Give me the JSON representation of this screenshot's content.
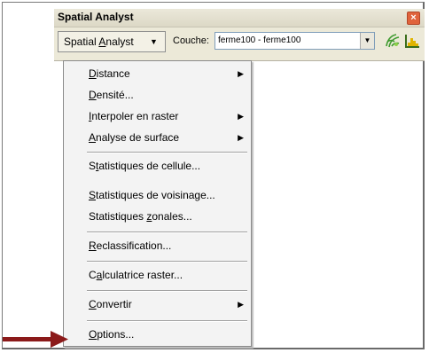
{
  "panel": {
    "title": "Spatial Analyst",
    "close_icon": "close-icon"
  },
  "toolbar": {
    "menu_button": {
      "pre": "Spatial ",
      "key": "A",
      "post": "nalyst"
    },
    "layer_label": "Couche:",
    "layer_value": "ferme100 - ferme100",
    "icons": [
      "map-tool-icon",
      "histogram-icon"
    ]
  },
  "menu": {
    "items": [
      {
        "pre": "",
        "key": "D",
        "post": "istance"
      },
      {
        "pre": "",
        "key": "D",
        "post": "ensité..."
      },
      {
        "pre": "",
        "key": "I",
        "post": "nterpoler en raster"
      },
      {
        "pre": "",
        "key": "A",
        "post": "nalyse de surface"
      },
      {
        "pre": "S",
        "key": "t",
        "post": "atistiques de cellule..."
      },
      {
        "pre": "",
        "key": "S",
        "post": "tatistiques de voisinage..."
      },
      {
        "pre": "Statistiques ",
        "key": "z",
        "post": "onales..."
      },
      {
        "pre": "",
        "key": "R",
        "post": "eclassification..."
      },
      {
        "pre": "C",
        "key": "a",
        "post": "lculatrice raster..."
      },
      {
        "pre": "",
        "key": "C",
        "post": "onvertir"
      },
      {
        "pre": "",
        "key": "O",
        "post": "ptions..."
      }
    ]
  },
  "colors": {
    "arrow": "#8b1a1a",
    "toolbar_bg": "#ece9d8"
  }
}
